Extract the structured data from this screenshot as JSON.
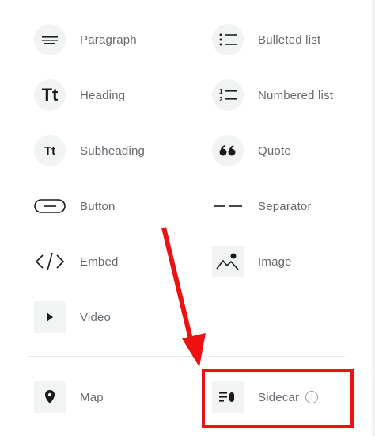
{
  "blocks": {
    "paragraph": {
      "label": "Paragraph",
      "icon": "paragraph-icon"
    },
    "bulleted_list": {
      "label": "Bulleted list",
      "icon": "bulleted-list-icon"
    },
    "heading": {
      "label": "Heading",
      "icon": "heading-icon",
      "glyph": "Tt"
    },
    "numbered_list": {
      "label": "Numbered list",
      "icon": "numbered-list-icon"
    },
    "subheading": {
      "label": "Subheading",
      "icon": "subheading-icon",
      "glyph": "Tt"
    },
    "quote": {
      "label": "Quote",
      "icon": "quote-icon"
    },
    "button": {
      "label": "Button",
      "icon": "button-icon"
    },
    "separator": {
      "label": "Separator",
      "icon": "separator-icon"
    },
    "embed": {
      "label": "Embed",
      "icon": "embed-icon"
    },
    "image": {
      "label": "Image",
      "icon": "image-icon"
    },
    "video": {
      "label": "Video",
      "icon": "video-icon"
    }
  },
  "extras": {
    "map": {
      "label": "Map",
      "icon": "map-pin-icon"
    },
    "sidecar": {
      "label": "Sidecar",
      "icon": "sidecar-icon",
      "info_glyph": "i"
    }
  },
  "annotation": {
    "color": "#ee1111",
    "target": "sidecar"
  }
}
